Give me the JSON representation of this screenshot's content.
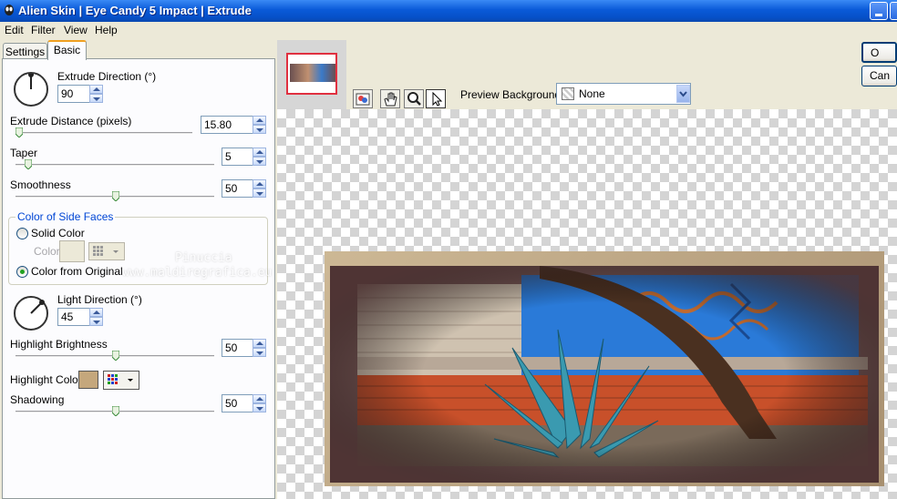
{
  "window": {
    "title": "Alien Skin | Eye Candy 5 Impact | Extrude"
  },
  "menu": {
    "items": [
      "Edit",
      "Filter",
      "View",
      "Help"
    ]
  },
  "tabs": {
    "settings": "Settings",
    "basic": "Basic"
  },
  "controls": {
    "extrude_direction": {
      "label": "Extrude Direction (°)",
      "value": "90"
    },
    "extrude_distance": {
      "label": "Extrude Distance (pixels)",
      "value": "15.80"
    },
    "taper": {
      "label": "Taper",
      "value": "5"
    },
    "smoothness": {
      "label": "Smoothness",
      "value": "50"
    },
    "side_faces": {
      "title": "Color of Side Faces",
      "solid_color": "Solid Color",
      "color_label": "Color",
      "from_original": "Color from Original",
      "selected": "Color from Original"
    },
    "light_direction": {
      "label": "Light Direction (°)",
      "value": "45"
    },
    "highlight_brightness": {
      "label": "Highlight Brightness",
      "value": "50"
    },
    "highlight_color": {
      "label": "Highlight Color",
      "swatch": "#c4a77c"
    },
    "shadowing": {
      "label": "Shadowing",
      "value": "50"
    }
  },
  "preview": {
    "background_label": "Preview Background:",
    "background_value": "None",
    "tools": [
      "preview-toggle-icon",
      "hand-icon",
      "zoom-icon",
      "pointer-icon"
    ]
  },
  "buttons": {
    "ok": "O",
    "cancel": "Can"
  },
  "watermark": {
    "line1": "Pinuccia",
    "line2": "www.maldiregrafica.eu"
  },
  "colors": {
    "accent": "#0a5ad8",
    "side_face": "#c4a77c",
    "group_title": "#0046d5"
  }
}
